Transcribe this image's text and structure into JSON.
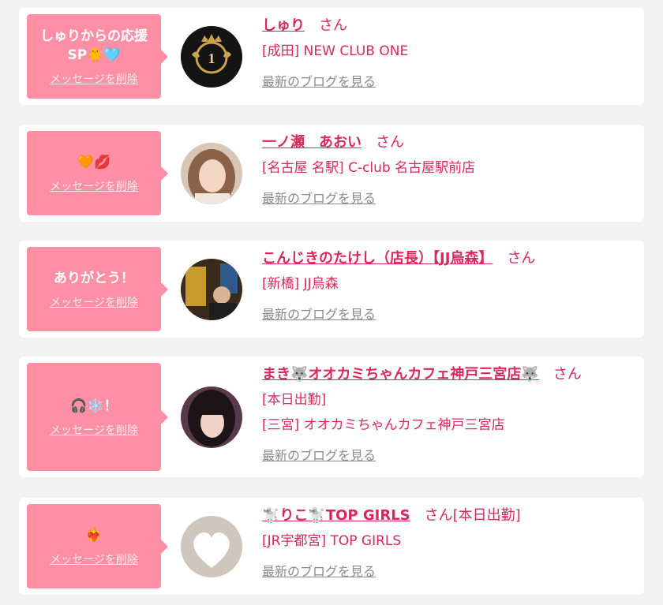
{
  "cards": [
    {
      "message": "しゅりからの応援SP🐥🩵",
      "delete_label": "メッセージを削除",
      "name": "しゅり",
      "honorific": "さん",
      "suffix": "",
      "lines": [
        "[成田] NEW CLUB ONE"
      ],
      "blog_label": "最新のブログを見る"
    },
    {
      "message": "🧡💋",
      "delete_label": "メッセージを削除",
      "name": "一ノ瀬　あおい",
      "honorific": "さん",
      "suffix": "",
      "lines": [
        "[名古屋 名駅] C-club 名古屋駅前店"
      ],
      "blog_label": "最新のブログを見る"
    },
    {
      "message": "ありがとう！",
      "delete_label": "メッセージを削除",
      "name": "こんじきのたけし（店長）【JJ烏森】",
      "honorific": "さん",
      "suffix": "",
      "lines": [
        "[新橋] JJ烏森"
      ],
      "blog_label": "最新のブログを見る"
    },
    {
      "message": "🎧❄️！",
      "delete_label": "メッセージを削除",
      "name": "まき🐺オオカミちゃんカフェ神戸三宮店🐺",
      "honorific": "さん",
      "suffix": "",
      "lines": [
        "[本日出勤]",
        "[三宮] オオカミちゃんカフェ神戸三宮店"
      ],
      "blog_label": "最新のブログを見る"
    },
    {
      "message": "❤️‍🔥",
      "delete_label": "メッセージを削除",
      "name": "🐩りこ🐩TOP GIRLS",
      "honorific": "さん",
      "suffix": "[本日出勤]",
      "lines": [
        "[JR宇都宮] TOP GIRLS"
      ],
      "blog_label": "最新のブログを見る"
    }
  ],
  "colors": {
    "accent": "#d8295a",
    "bubble": "#ff8fa5",
    "background": "#f2f2f2"
  }
}
